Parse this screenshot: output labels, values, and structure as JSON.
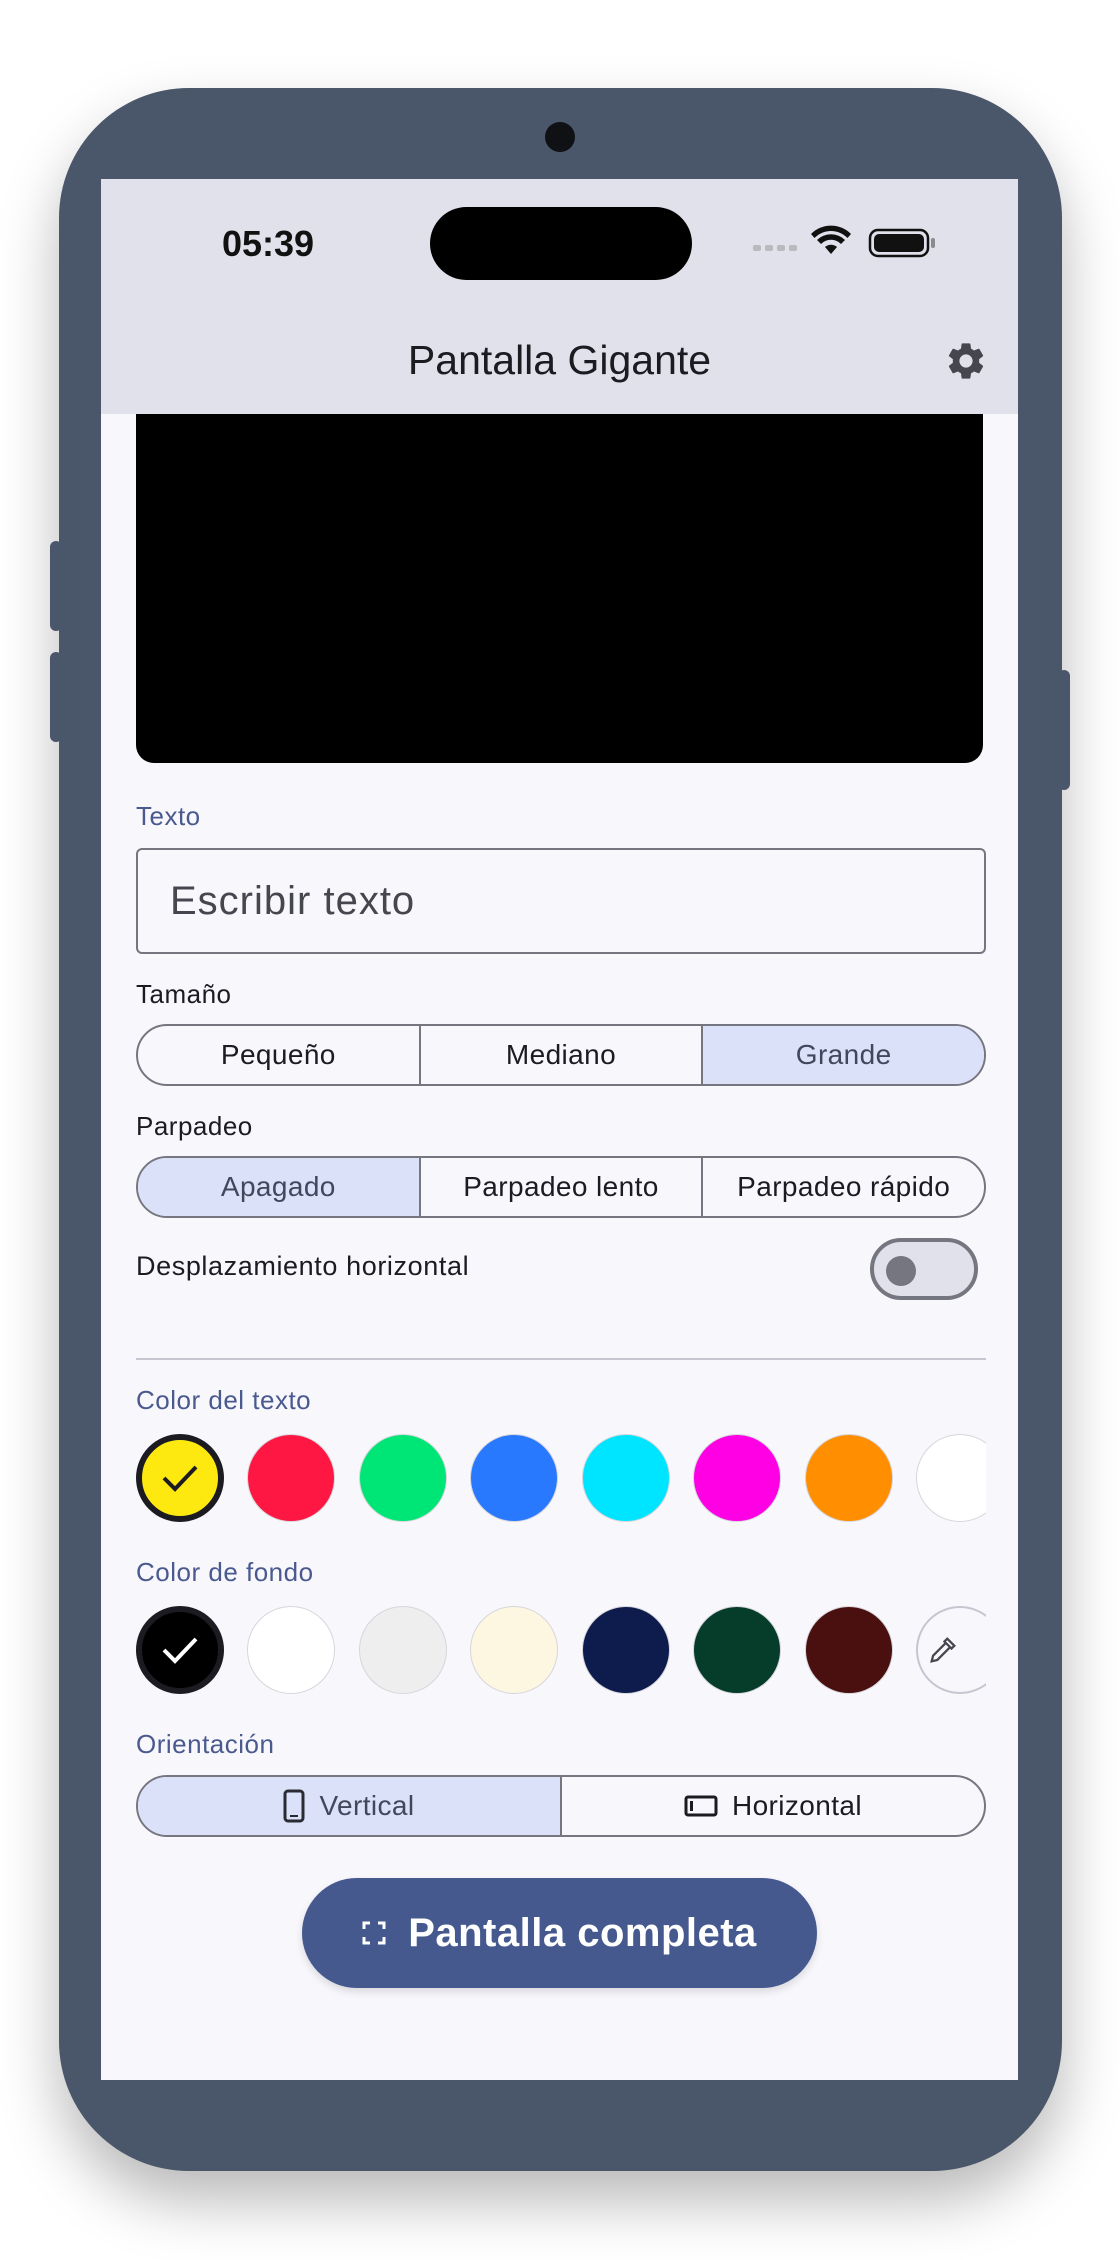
{
  "status_bar": {
    "time": "05:39"
  },
  "app_bar": {
    "title": "Pantalla Gigante",
    "settings_icon": "gear-icon"
  },
  "text_section": {
    "label": "Texto",
    "input_value": "",
    "input_placeholder": "Escribir texto"
  },
  "size": {
    "label": "Tamaño",
    "options": [
      "Pequeño",
      "Mediano",
      "Grande"
    ],
    "selected": "Grande"
  },
  "blink": {
    "label": "Parpadeo",
    "options": [
      "Apagado",
      "Parpadeo lento",
      "Parpadeo rápido"
    ],
    "selected": "Apagado"
  },
  "scroll": {
    "label": "Desplazamiento horizontal",
    "enabled": false
  },
  "text_color": {
    "label": "Color del texto",
    "swatches": [
      "#fde910",
      "#ff1744",
      "#00e676",
      "#2979ff",
      "#00e5ff",
      "#ff00e5",
      "#ff8f00",
      "#ffffff"
    ],
    "selected": "#fde910"
  },
  "bg_color": {
    "label": "Color de fondo",
    "swatches": [
      "#000000",
      "#ffffff",
      "#eeeeee",
      "#fdf6e0",
      "#0d1b4d",
      "#063d2a",
      "#4a0f0f"
    ],
    "selected": "#000000",
    "picker_icon": "eyedropper-icon"
  },
  "orientation": {
    "label": "Orientación",
    "options": [
      {
        "label": "Vertical",
        "icon": "phone-portrait-icon"
      },
      {
        "label": "Horizontal",
        "icon": "phone-landscape-icon"
      }
    ],
    "selected": "Vertical"
  },
  "fullscreen": {
    "label": "Pantalla completa",
    "icon": "fullscreen-icon"
  },
  "colors": {
    "accent": "#45598e",
    "selected_segment": "#dbe1f9",
    "device_frame": "#4a566a"
  }
}
